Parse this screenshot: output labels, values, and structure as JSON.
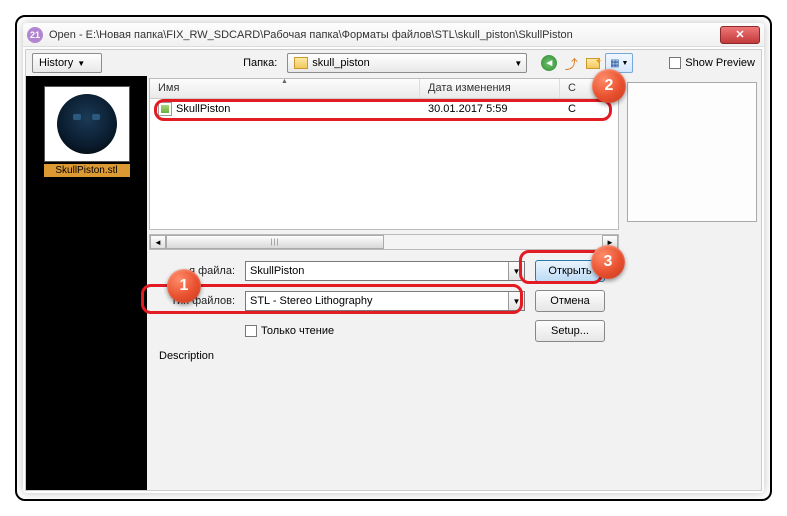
{
  "window": {
    "title": "Open - E:\\Новая папка\\FIX_RW_SDCARD\\Рабочая папка\\Форматы файлов\\STL\\skull_piston\\SkullPiston",
    "appicon_text": "21"
  },
  "toolbar": {
    "history_label": "History",
    "folder_label": "Папка:",
    "folder_value": "skull_piston",
    "show_preview": "Show Preview"
  },
  "thumbnail": {
    "filename": "SkullPiston.stl"
  },
  "list": {
    "col_name": "Имя",
    "col_date": "Дата изменения",
    "col_size_frag": "C",
    "rows": [
      {
        "name": "SkullPiston",
        "date": "30.01.2017 5:59",
        "size_frag": "C"
      }
    ]
  },
  "form": {
    "filename_label": "я файла:",
    "filename_value": "SkullPiston",
    "filetype_label": "Тип файлов:",
    "filetype_value": "STL  - Stereo Lithography",
    "open_btn": "Открыть",
    "cancel_btn": "Отмена",
    "setup_btn": "Setup...",
    "readonly": "Только чтение",
    "description": "Description"
  },
  "markers": {
    "m1": "1",
    "m2": "2",
    "m3": "3"
  }
}
